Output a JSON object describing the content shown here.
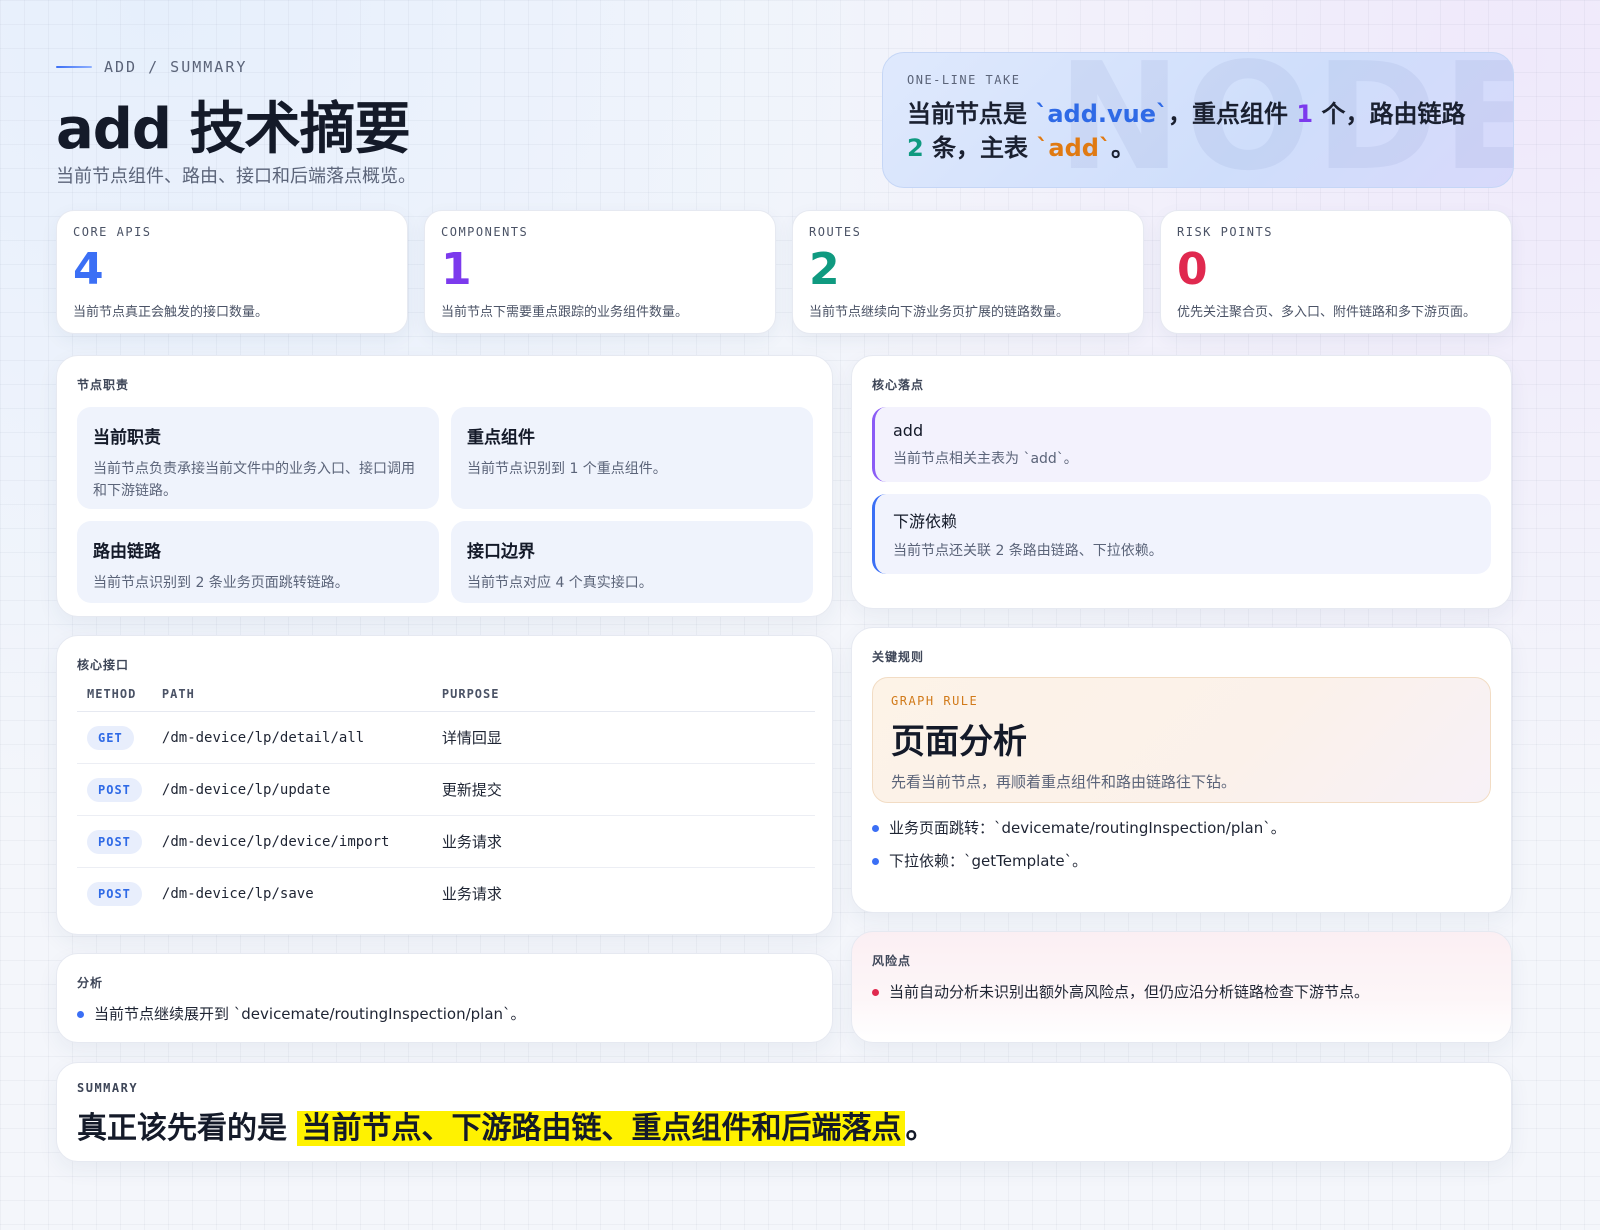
{
  "header": {
    "eyebrow": "ADD / SUMMARY",
    "title": "add 技术摘要",
    "subtitle": "当前节点组件、路由、接口和后端落点概览。"
  },
  "take": {
    "label": "ONE-LINE TAKE",
    "watermark": "NODE",
    "p1": "当前节点是 ",
    "file": "`add.vue`",
    "p2": "，重点组件 ",
    "components": "1",
    "p3": " 个，路由链路 ",
    "routes": "2",
    "p4": " 条，主表 ",
    "table": "`add`",
    "p5": "。"
  },
  "stats": [
    {
      "label": "CORE APIS",
      "value": "4",
      "desc": "当前节点真正会触发的接口数量。",
      "color": "#3b6ff5"
    },
    {
      "label": "COMPONENTS",
      "value": "1",
      "desc": "当前节点下需要重点跟踪的业务组件数量。",
      "color": "#7c3aed"
    },
    {
      "label": "ROUTES",
      "value": "2",
      "desc": "当前节点继续向下游业务页扩展的链路数量。",
      "color": "#0f9a80"
    },
    {
      "label": "RISK POINTS",
      "value": "0",
      "desc": "优先关注聚合页、多入口、附件链路和多下游页面。",
      "color": "#e0294f"
    }
  ],
  "duties": {
    "title": "节点职责",
    "items": [
      {
        "title": "当前职责",
        "desc": "当前节点负责承接当前文件中的业务入口、接口调用和下游链路。"
      },
      {
        "title": "重点组件",
        "desc": "当前节点识别到 1 个重点组件。"
      },
      {
        "title": "路由链路",
        "desc": "当前节点识别到 2 条业务页面跳转链路。"
      },
      {
        "title": "接口边界",
        "desc": "当前节点对应 4 个真实接口。"
      }
    ]
  },
  "focus": {
    "title": "核心落点",
    "items": [
      {
        "title": "add",
        "desc": "当前节点相关主表为 `add`。"
      },
      {
        "title": "下游依赖",
        "desc": "当前节点还关联 2 条路由链路、下拉依赖。"
      }
    ]
  },
  "apis": {
    "title": "核心接口",
    "headers": [
      "METHOD",
      "PATH",
      "PURPOSE"
    ],
    "rows": [
      {
        "method": "GET",
        "path": "/dm-device/lp/detail/all",
        "purpose": "详情回显"
      },
      {
        "method": "POST",
        "path": "/dm-device/lp/update",
        "purpose": "更新提交"
      },
      {
        "method": "POST",
        "path": "/dm-device/lp/device/import",
        "purpose": "业务请求"
      },
      {
        "method": "POST",
        "path": "/dm-device/lp/save",
        "purpose": "业务请求"
      }
    ]
  },
  "rules": {
    "title": "关键规则",
    "box_label": "GRAPH RULE",
    "box_title": "页面分析",
    "box_desc": "先看当前节点，再顺着重点组件和路由链路往下钻。",
    "bullets": [
      "业务页面跳转：`devicemate/routingInspection/plan`。",
      "下拉依赖：`getTemplate`。"
    ]
  },
  "analysis": {
    "title": "分析",
    "bullets": [
      "当前节点继续展开到 `devicemate/routingInspection/plan`。"
    ]
  },
  "risks": {
    "title": "风险点",
    "bullets": [
      "当前自动分析未识别出额外高风险点，但仍应沿分析链路检查下游节点。"
    ]
  },
  "summary": {
    "label": "SUMMARY",
    "lead": "真正该先看的是 ",
    "highlight": "当前节点、下游路由链、重点组件和后端落点",
    "tail": "。"
  }
}
